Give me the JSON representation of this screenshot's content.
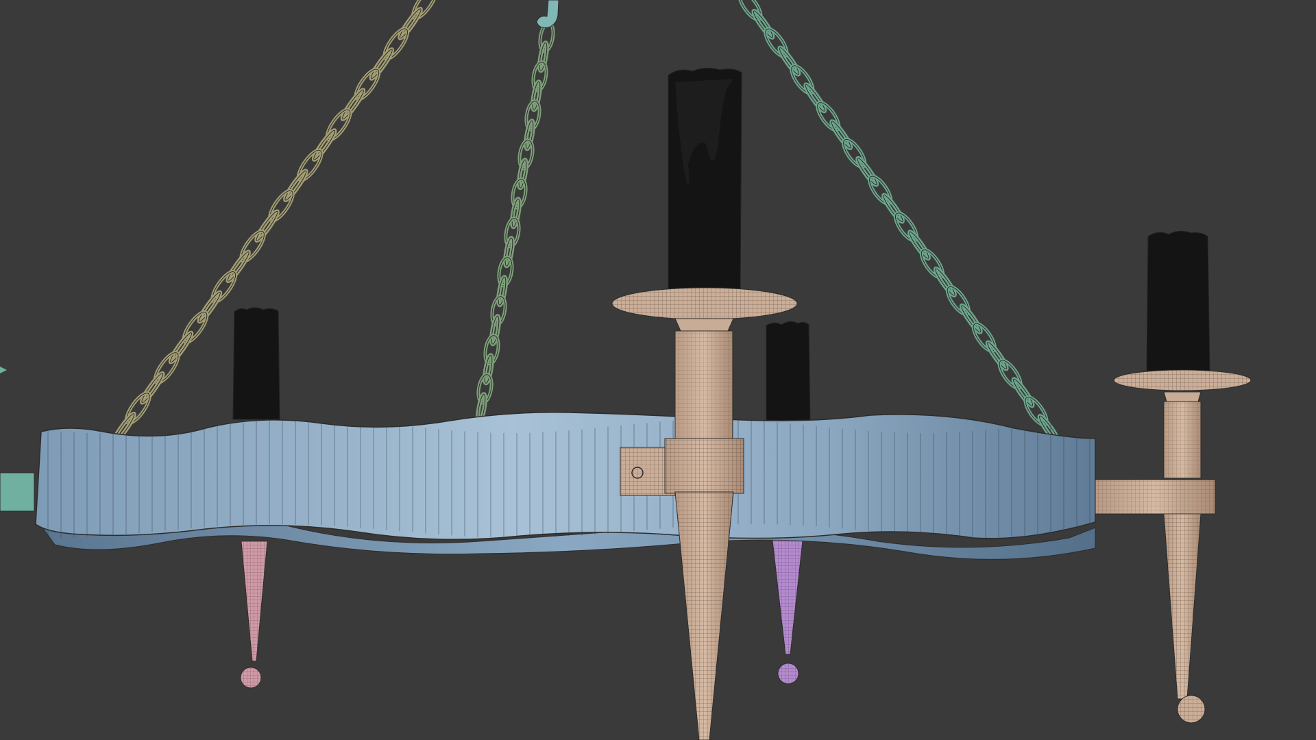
{
  "scene": {
    "background": "#3a3a3a",
    "chain_colors": {
      "left": "#a49e74",
      "middle": "#7fa07a",
      "right": "#6ea58c",
      "hook": "#7fb8b4"
    },
    "ring_colors": {
      "light": "#a9c2d6",
      "mid": "#8aa6bf",
      "dark": "#5d7891"
    },
    "wood_color": "#cbae98",
    "candle_color": "#151515",
    "pink_color": "#cf9aa6",
    "purple_color": "#b58bcf",
    "wire_color": "#2c2c2c"
  }
}
